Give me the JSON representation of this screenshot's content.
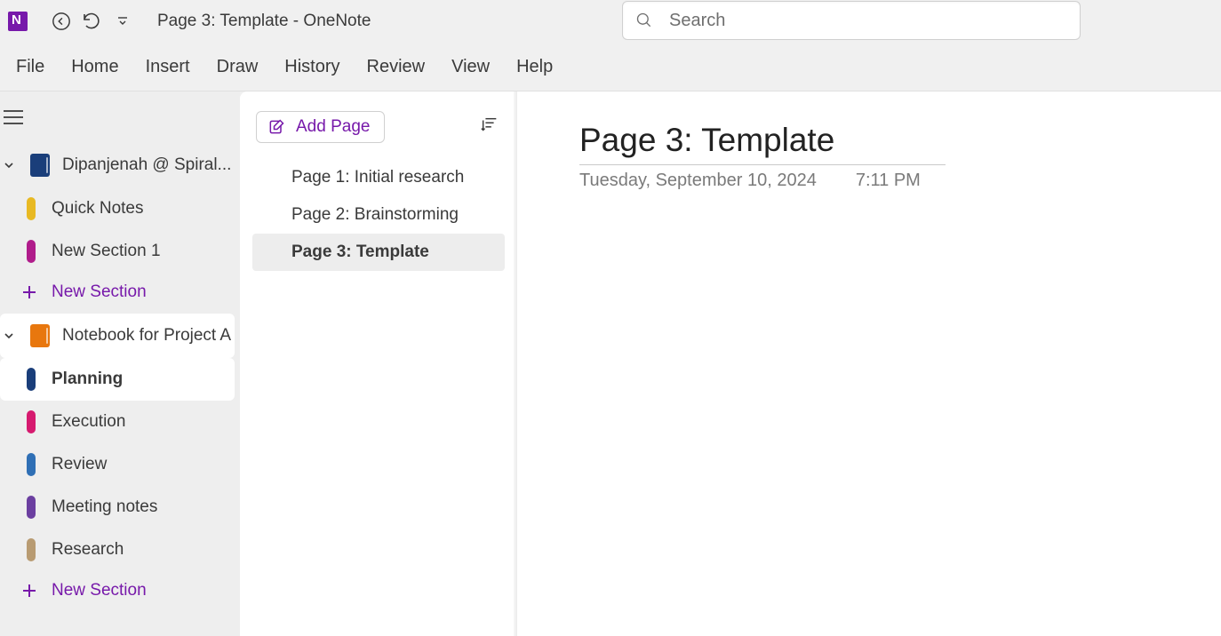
{
  "titlebar": {
    "title": "Page 3: Template  -  OneNote"
  },
  "search": {
    "placeholder": "Search"
  },
  "ribbon": [
    "File",
    "Home",
    "Insert",
    "Draw",
    "History",
    "Review",
    "View",
    "Help"
  ],
  "notebooks": [
    {
      "name": "Dipanjenah @ Spiral...",
      "color": "darkblue",
      "expanded": true,
      "sections": [
        {
          "name": "Quick Notes",
          "color": "#e8b923",
          "active": false
        },
        {
          "name": "New Section 1",
          "color": "#b01c8b",
          "active": false
        }
      ],
      "add_label": "New Section"
    },
    {
      "name": "Notebook for Project A",
      "color": "orange",
      "expanded": true,
      "sections": [
        {
          "name": "Planning",
          "color": "#1a3e7a",
          "active": true
        },
        {
          "name": "Execution",
          "color": "#d61a6f",
          "active": false
        },
        {
          "name": "Review",
          "color": "#2f6fb5",
          "active": false
        },
        {
          "name": "Meeting notes",
          "color": "#6b3fa0",
          "active": false
        },
        {
          "name": "Research",
          "color": "#b89b72",
          "active": false
        }
      ],
      "add_label": "New Section"
    }
  ],
  "pages_panel": {
    "add_label": "Add Page",
    "pages": [
      {
        "title": "Page 1: Initial research",
        "selected": false
      },
      {
        "title": "Page 2: Brainstorming",
        "selected": false
      },
      {
        "title": "Page 3: Template",
        "selected": true
      }
    ]
  },
  "page": {
    "title": "Page 3: Template",
    "date": "Tuesday, September 10, 2024",
    "time": "7:11 PM"
  }
}
